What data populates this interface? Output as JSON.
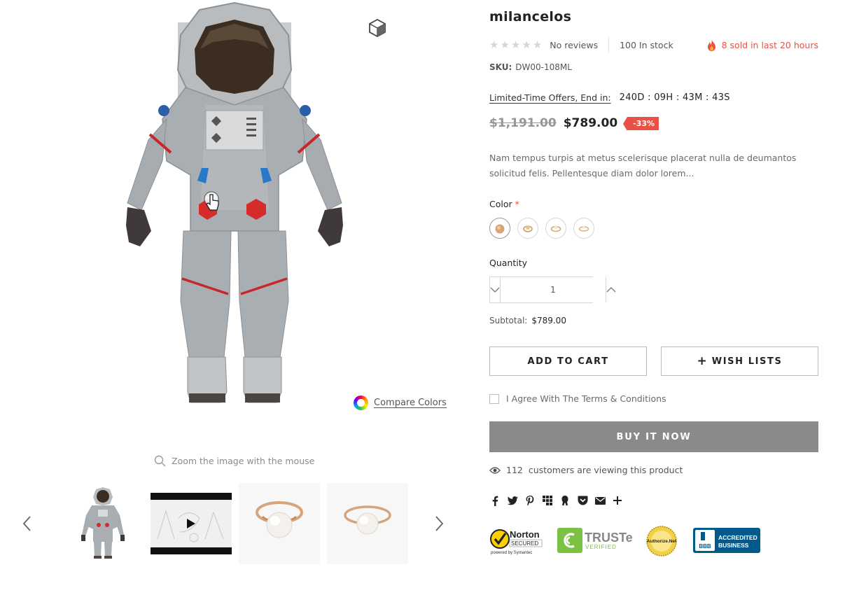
{
  "gallery": {
    "compare_colors": "Compare Colors",
    "zoom_hint": "Zoom the image with the mouse"
  },
  "product": {
    "title": "milancelos",
    "rating": 0,
    "rating_max": 5,
    "reviews": "No reviews",
    "stock": "100 In stock",
    "sold": "8 sold in last 20 hours",
    "sku_label": "SKU:",
    "sku_value": "DW00-108ML",
    "offer_label": "Limited-Time Offers, End in:",
    "countdown": "240D : 09H : 43M : 43S",
    "price_old": "$1,191.00",
    "price_new": "$789.00",
    "discount": "-33%",
    "description": "Nam tempus turpis at metus scelerisque placerat nulla de deumantos solicitud felis. Pellentesque diam dolor lorem...",
    "color_label": "Color",
    "required_mark": "*",
    "quantity_label": "Quantity",
    "quantity_value": "1",
    "subtotal_label": "Subtotal:",
    "subtotal_value": "$789.00"
  },
  "actions": {
    "add_to_cart": "ADD TO CART",
    "wish_lists": "WISH LISTS",
    "terms": "I Agree With The Terms & Conditions",
    "buy_now": "BUY IT NOW"
  },
  "viewing": {
    "count": "112",
    "text": "customers are viewing this product"
  },
  "trust": {
    "norton_brand": "Norton",
    "norton_secured": "SECURED",
    "norton_sub": "powered by Symantec",
    "truste_brand": "TRUSTe",
    "truste_sub": "VERIFIED",
    "authorize_brand": "Authorize.Net",
    "bbb_logo": "BBB",
    "bbb_line1": "ACCREDITED",
    "bbb_line2": "BUSINESS"
  },
  "colors": {
    "accent_red": "#e95144",
    "buy_now_bg": "#8a8a8a"
  }
}
